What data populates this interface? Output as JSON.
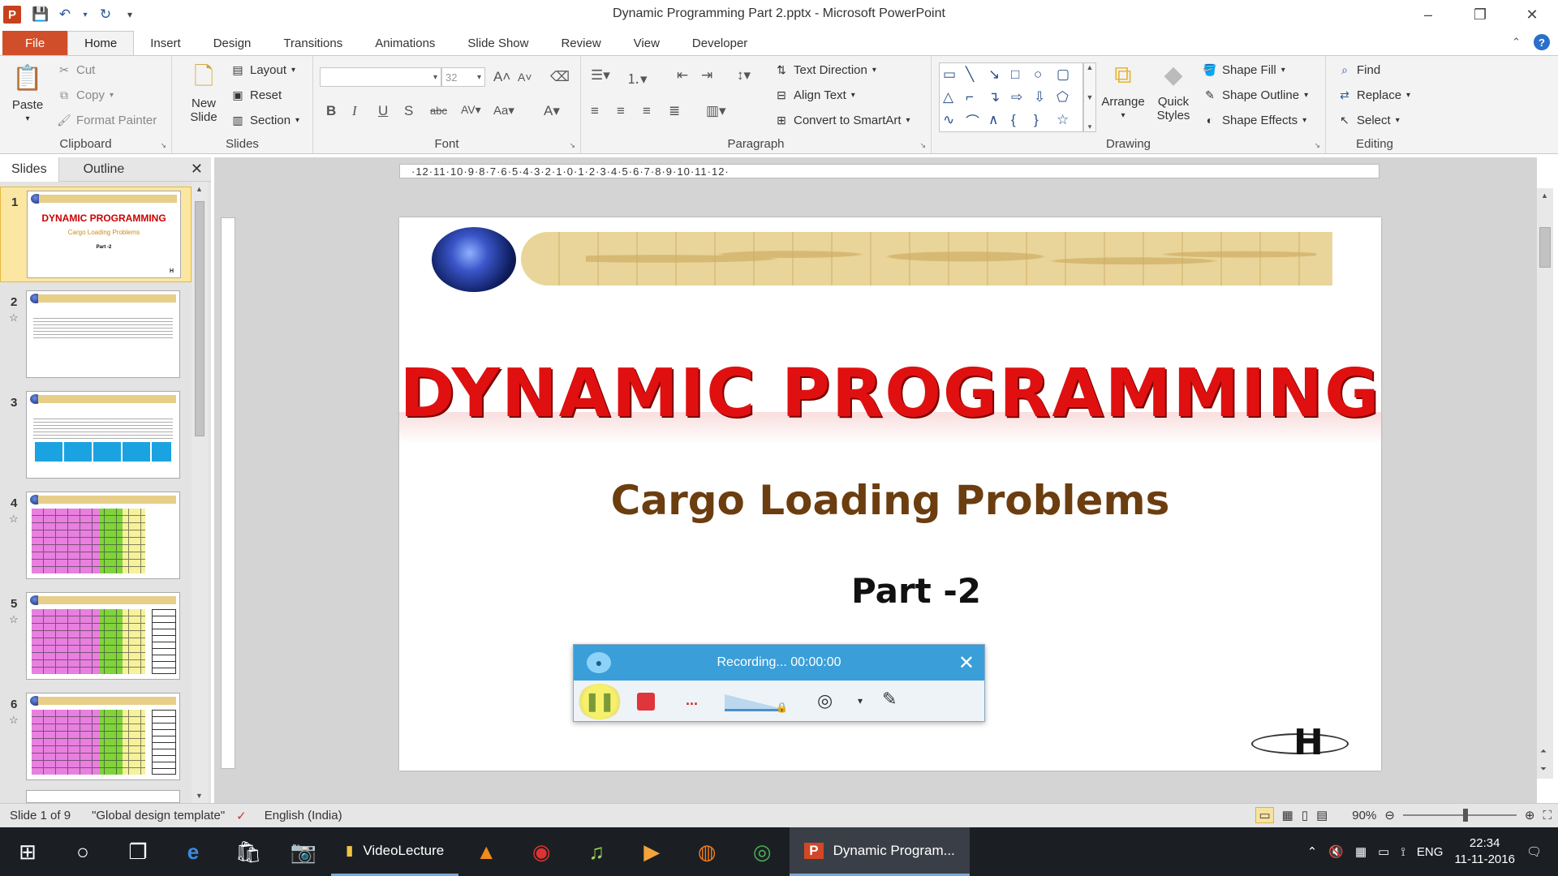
{
  "window": {
    "title": "Dynamic Programming Part 2.pptx - Microsoft PowerPoint",
    "app_icon": "P"
  },
  "ribbon_tabs": [
    "File",
    "Home",
    "Insert",
    "Design",
    "Transitions",
    "Animations",
    "Slide Show",
    "Review",
    "View",
    "Developer"
  ],
  "active_tab": "Home",
  "clipboard": {
    "paste": "Paste",
    "cut": "Cut",
    "copy": "Copy",
    "format_painter": "Format Painter",
    "label": "Clipboard"
  },
  "slides_group": {
    "new_slide": "New Slide",
    "layout": "Layout",
    "reset": "Reset",
    "section": "Section",
    "label": "Slides"
  },
  "font_group": {
    "font_name": "",
    "font_size": "32",
    "label": "Font"
  },
  "paragraph_group": {
    "text_direction": "Text Direction",
    "align_text": "Align Text",
    "convert_smartart": "Convert to SmartArt",
    "label": "Paragraph"
  },
  "drawing_group": {
    "arrange": "Arrange",
    "quick_styles": "Quick Styles",
    "shape_fill": "Shape Fill",
    "shape_outline": "Shape Outline",
    "shape_effects": "Shape Effects",
    "label": "Drawing"
  },
  "editing_group": {
    "find": "Find",
    "replace": "Replace",
    "select": "Select",
    "label": "Editing"
  },
  "pane": {
    "tabs": [
      "Slides",
      "Outline"
    ],
    "active": "Slides",
    "thumbnails": [
      {
        "num": "1",
        "title": "DYNAMIC PROGRAMMING",
        "subtitle": "Cargo Loading Problems",
        "part": "Part -2"
      },
      {
        "num": "2"
      },
      {
        "num": "3"
      },
      {
        "num": "4"
      },
      {
        "num": "5"
      },
      {
        "num": "6"
      }
    ]
  },
  "ruler": {
    "horizontal": "·12·11·10·9·8·7·6·5·4·3·2·1·0·1·2·3·4·5·6·7·8·9·10·11·12·"
  },
  "slide": {
    "title": "DYNAMIC PROGRAMMING",
    "subtitle": "Cargo Loading Problems",
    "part": "Part -2",
    "logo_letter": "H",
    "colors": {
      "title": "#e01010",
      "subtitle": "#6b3d0f"
    }
  },
  "recorder": {
    "status": "Recording... 00:00:00"
  },
  "status_bar": {
    "slide_info": "Slide 1 of 9",
    "theme": "\"Global design template\"",
    "language": "English (India)",
    "zoom": "90%"
  },
  "taskbar": {
    "apps": [
      {
        "label": "VideoLecture",
        "active": false
      },
      {
        "label": "Dynamic Program...",
        "active": true
      }
    ],
    "language": "ENG",
    "time": "22:34",
    "date": "11-11-2016"
  }
}
